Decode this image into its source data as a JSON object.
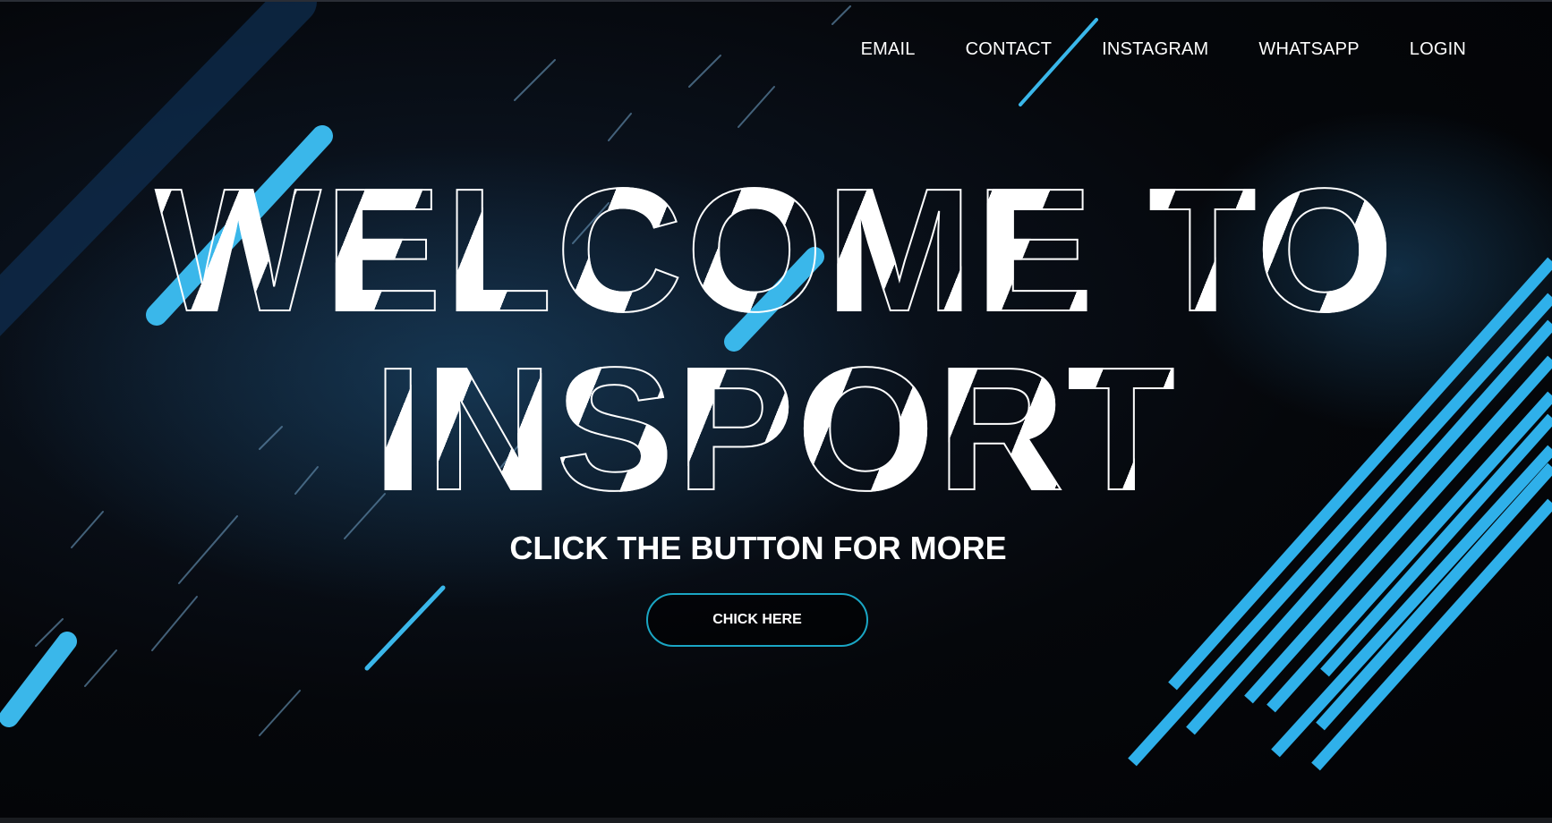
{
  "nav": {
    "items": [
      {
        "label": "EMAIL"
      },
      {
        "label": "CONTACT"
      },
      {
        "label": "INSTAGRAM"
      },
      {
        "label": "WHATSAPP"
      },
      {
        "label": "LOGIN"
      }
    ]
  },
  "hero": {
    "title_line1": "WELCOME TO",
    "title_line2": "INSPORT",
    "subtitle": "CLICK THE BUTTON FOR MORE",
    "cta_label": "CHICK HERE"
  },
  "colors": {
    "accent": "#29b6e8",
    "button_border": "#1aa6c4",
    "background": "#05070b",
    "text": "#ffffff"
  }
}
